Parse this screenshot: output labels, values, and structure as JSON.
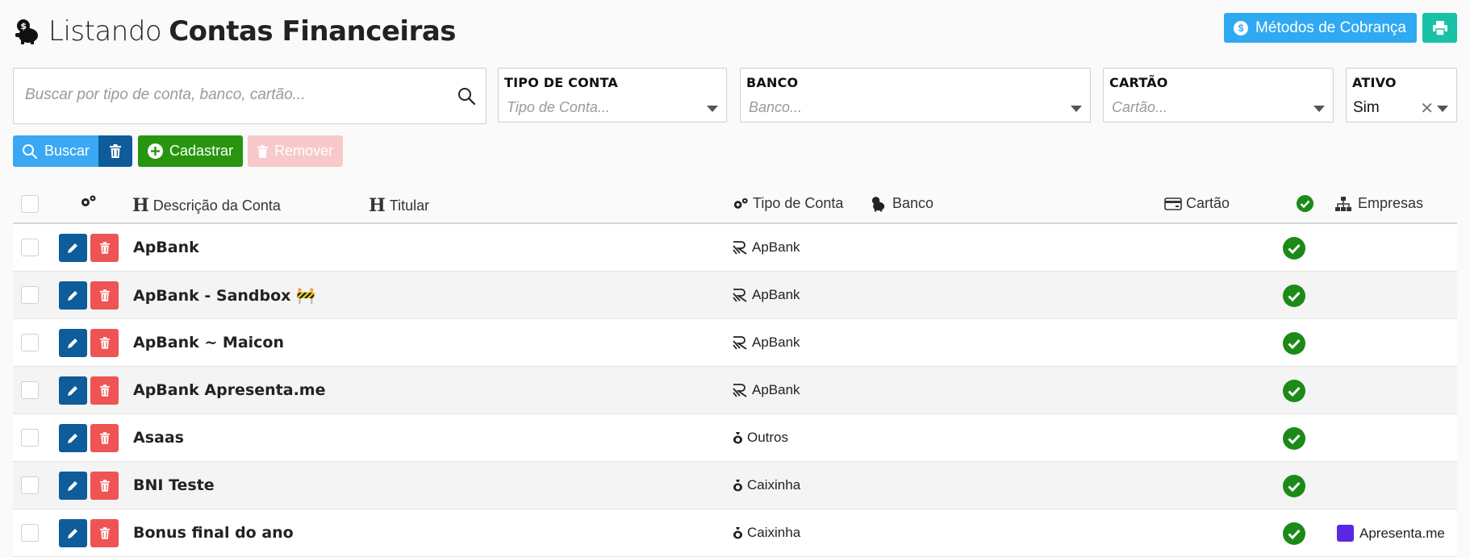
{
  "header": {
    "title_light": "Listando",
    "title_bold": "Contas Financeiras",
    "metodos_label": "Métodos de Cobrança"
  },
  "filters": {
    "search_placeholder": "Buscar por tipo de conta, banco, cartão...",
    "tipo_conta": {
      "label": "TIPO DE CONTA",
      "placeholder": "Tipo de Conta..."
    },
    "banco": {
      "label": "BANCO",
      "placeholder": "Banco..."
    },
    "cartao": {
      "label": "CARTÃO",
      "placeholder": "Cartão..."
    },
    "ativo": {
      "label": "ATIVO",
      "value": "Sim"
    }
  },
  "actions": {
    "buscar": "Buscar",
    "cadastrar": "Cadastrar",
    "remover": "Remover"
  },
  "columns": {
    "descricao": "Descrição da Conta",
    "titular": "Titular",
    "tipo": "Tipo de Conta",
    "banco": "Banco",
    "cartao": "Cartão",
    "empresas": "Empresas"
  },
  "rows": [
    {
      "descricao": "ApBank",
      "tipo": "ApBank",
      "tipo_icon": "apbank-icon",
      "empresa": ""
    },
    {
      "descricao": "ApBank - Sandbox 🚧",
      "tipo": "ApBank",
      "tipo_icon": "apbank-icon",
      "empresa": ""
    },
    {
      "descricao": "ApBank ~ Maicon",
      "tipo": "ApBank",
      "tipo_icon": "apbank-icon",
      "empresa": ""
    },
    {
      "descricao": "ApBank Apresenta.me",
      "tipo": "ApBank",
      "tipo_icon": "apbank-icon",
      "empresa": ""
    },
    {
      "descricao": "Asaas",
      "tipo": "Outros",
      "tipo_icon": "money-bag-icon",
      "empresa": ""
    },
    {
      "descricao": "BNI Teste",
      "tipo": "Caixinha",
      "tipo_icon": "money-bag-icon",
      "empresa": ""
    },
    {
      "descricao": "Bonus final do ano",
      "tipo": "Caixinha",
      "tipo_icon": "money-bag-icon",
      "empresa": "Apresenta.me"
    }
  ],
  "colors": {
    "primary": "#0e5c99",
    "info": "#2fa9f2",
    "success": "#28950f",
    "danger": "#ee5454",
    "teal": "#17c2a6",
    "active_check": "#1b8a18",
    "empresa_badge": "#5b27e3"
  }
}
